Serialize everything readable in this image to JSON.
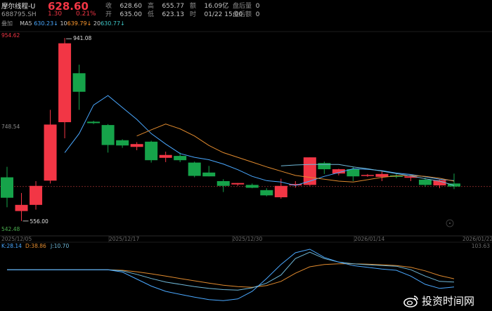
{
  "header": {
    "name": "摩尔线程-U",
    "code": "688795.SH",
    "price": "628.60",
    "change": "1.30",
    "change_pct": "0.21%",
    "stats": [
      {
        "label": "收",
        "value": "628.60"
      },
      {
        "label": "开",
        "value": "635.00"
      },
      {
        "label": "高",
        "value": "655.77"
      },
      {
        "label": "低",
        "value": "623.13"
      },
      {
        "label": "额",
        "value": "16.09亿"
      },
      {
        "label": "时",
        "value": "01/22 15:00"
      },
      {
        "label": "盘后量",
        "value": "0"
      },
      {
        "label": "盘后额",
        "value": "0"
      }
    ],
    "ma_prefix": "叠加",
    "ma": [
      {
        "label": "MA5",
        "value": "630.23↓",
        "color": "#4aa8ff"
      },
      {
        "label": "10",
        "value": "639.79↓",
        "color": "#ff9a2e"
      },
      {
        "label": "20",
        "value": "630.77↓",
        "color": "#3ec9c9"
      }
    ]
  },
  "watermark": "投资时间网",
  "chart_data": {
    "type": "candlestick",
    "colors": {
      "up": "#f23645",
      "down": "#16a34a",
      "ma5": "#4aa8ff",
      "ma10": "#e08a2e",
      "ma20": "#6fb8d8",
      "k": "#6fb8d8",
      "d": "#e08a2e",
      "j": "#4aa8ff"
    },
    "ylim": [
      542.48,
      954.62
    ],
    "y_axis_labels": [
      "954.62",
      "748.54",
      "542.48"
    ],
    "x_tick_labels": [
      "2025/12/05",
      "2025/12/17",
      "2025/12/30",
      "2026/01/14",
      "2026/01/22"
    ],
    "annotations": {
      "high": "941.08",
      "low": "556.00"
    },
    "candles": [
      {
        "o": 648,
        "h": 670,
        "l": 585,
        "c": 605
      },
      {
        "o": 577,
        "h": 615,
        "l": 556,
        "c": 590
      },
      {
        "o": 590,
        "h": 640,
        "l": 580,
        "c": 630
      },
      {
        "o": 641,
        "h": 790,
        "l": 635,
        "c": 759
      },
      {
        "o": 764,
        "h": 941.08,
        "l": 730,
        "c": 930
      },
      {
        "o": 867,
        "h": 885,
        "l": 790,
        "c": 828
      },
      {
        "o": 765,
        "h": 767,
        "l": 760,
        "c": 762
      },
      {
        "o": 758,
        "h": 760,
        "l": 700,
        "c": 716
      },
      {
        "o": 726,
        "h": 728,
        "l": 710,
        "c": 715
      },
      {
        "o": 712,
        "h": 722,
        "l": 705,
        "c": 718
      },
      {
        "o": 723,
        "h": 725,
        "l": 679,
        "c": 684
      },
      {
        "o": 689,
        "h": 702,
        "l": 680,
        "c": 695
      },
      {
        "o": 693,
        "h": 700,
        "l": 680,
        "c": 684
      },
      {
        "o": 679,
        "h": 681,
        "l": 648,
        "c": 651
      },
      {
        "o": 658,
        "h": 672,
        "l": 650,
        "c": 650
      },
      {
        "o": 640,
        "h": 644,
        "l": 617,
        "c": 630
      },
      {
        "o": 633,
        "h": 636,
        "l": 630,
        "c": 636
      },
      {
        "o": 632,
        "h": 635,
        "l": 625,
        "c": 626
      },
      {
        "o": 621,
        "h": 625,
        "l": 608,
        "c": 610
      },
      {
        "o": 606,
        "h": 645,
        "l": 603,
        "c": 630
      },
      {
        "o": 631,
        "h": 640,
        "l": 626,
        "c": 634
      },
      {
        "o": 632,
        "h": 690,
        "l": 630,
        "c": 690
      },
      {
        "o": 678,
        "h": 681,
        "l": 655,
        "c": 665
      },
      {
        "o": 656,
        "h": 666,
        "l": 652,
        "c": 665
      },
      {
        "o": 665,
        "h": 670,
        "l": 640,
        "c": 650
      },
      {
        "o": 652,
        "h": 655,
        "l": 649,
        "c": 653
      },
      {
        "o": 649,
        "h": 660,
        "l": 640,
        "c": 655
      },
      {
        "o": 652,
        "h": 656,
        "l": 646,
        "c": 649
      },
      {
        "o": 647,
        "h": 651,
        "l": 640,
        "c": 650
      },
      {
        "o": 643,
        "h": 647,
        "l": 628,
        "c": 632
      },
      {
        "o": 631,
        "h": 643,
        "l": 625,
        "c": 642
      },
      {
        "o": 635,
        "h": 655.77,
        "l": 623.13,
        "c": 628.6
      }
    ],
    "ma5": [
      null,
      null,
      null,
      null,
      700,
      740,
      800,
      820,
      795,
      770,
      740,
      718,
      698,
      690,
      685,
      676,
      664,
      650,
      641,
      638,
      631,
      640,
      650,
      658,
      666,
      665,
      662,
      657,
      654,
      649,
      644,
      641
    ],
    "ma10": [
      null,
      null,
      null,
      null,
      null,
      null,
      null,
      null,
      null,
      735,
      748,
      760,
      750,
      735,
      715,
      700,
      690,
      680,
      670,
      661,
      652,
      648,
      644,
      640,
      638,
      643,
      648,
      651,
      652,
      650,
      646,
      640
    ],
    "ma20": [
      null,
      null,
      null,
      null,
      null,
      null,
      null,
      null,
      null,
      null,
      null,
      null,
      null,
      null,
      null,
      null,
      null,
      null,
      null,
      672,
      674,
      675,
      675,
      675,
      670,
      666,
      661,
      656,
      651,
      645,
      640,
      631
    ],
    "kdj_labels": [
      "K:28.14",
      "D:38.86",
      "J:10.70"
    ],
    "kdj_axis_label": "103.63",
    "k": [
      null,
      null,
      null,
      null,
      null,
      null,
      null,
      70,
      66,
      54,
      40,
      28,
      20,
      12,
      6,
      2,
      0,
      8,
      24,
      52,
      108,
      130,
      108,
      96,
      90,
      87,
      84,
      82,
      70,
      48,
      30,
      28
    ],
    "d": [
      null,
      null,
      null,
      null,
      null,
      null,
      null,
      70,
      68,
      63,
      56,
      48,
      40,
      32,
      24,
      17,
      12,
      10,
      16,
      30,
      58,
      80,
      88,
      90,
      90,
      89,
      87,
      84,
      78,
      66,
      50,
      39
    ],
    "j": [
      null,
      null,
      null,
      null,
      null,
      null,
      null,
      70,
      62,
      38,
      14,
      -4,
      -14,
      -24,
      -32,
      -36,
      -30,
      -4,
      40,
      88,
      128,
      140,
      112,
      96,
      84,
      78,
      72,
      68,
      48,
      20,
      6,
      11
    ]
  }
}
